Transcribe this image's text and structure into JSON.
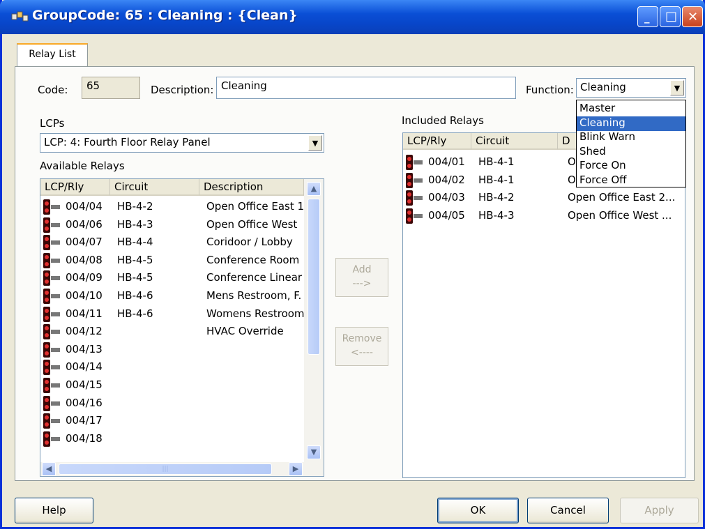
{
  "window": {
    "title": "GroupCode: 65 : Cleaning : {Clean}",
    "minimize_glyph": "_",
    "maximize_glyph": "□",
    "close_glyph": "✕"
  },
  "tabs": [
    {
      "label": "Relay List"
    }
  ],
  "form": {
    "code_label": "Code:",
    "code_value": "65",
    "description_label": "Description:",
    "description_value": "Cleaning",
    "function_label": "Function:",
    "function_value": "Cleaning"
  },
  "function_options": [
    "Master",
    "Cleaning",
    "Blink Warn",
    "Shed",
    "Force On",
    "Force Off"
  ],
  "function_selected_index": 1,
  "lcps": {
    "label": "LCPs",
    "selected": "LCP: 4: Fourth Floor Relay Panel"
  },
  "available": {
    "label": "Available Relays",
    "columns": [
      "LCP/Rly",
      "Circuit",
      "Description"
    ],
    "rows": [
      [
        "004/04",
        "HB-4-2",
        "Open Office East 1"
      ],
      [
        "004/06",
        "HB-4-3",
        "Open Office West"
      ],
      [
        "004/07",
        "HB-4-4",
        "Coridoor / Lobby"
      ],
      [
        "004/08",
        "HB-4-5",
        "Conference Room"
      ],
      [
        "004/09",
        "HB-4-5",
        "Conference Linear"
      ],
      [
        "004/10",
        "HB-4-6",
        "Mens Restroom, F."
      ],
      [
        "004/11",
        "HB-4-6",
        "Womens Restroom"
      ],
      [
        "004/12",
        "",
        "HVAC Override"
      ],
      [
        "004/13",
        "",
        ""
      ],
      [
        "004/14",
        "",
        ""
      ],
      [
        "004/15",
        "",
        ""
      ],
      [
        "004/16",
        "",
        ""
      ],
      [
        "004/17",
        "",
        ""
      ],
      [
        "004/18",
        "",
        ""
      ]
    ]
  },
  "included": {
    "label": "Included Relays",
    "columns": [
      "LCP/Rly",
      "Circuit",
      "D"
    ],
    "rows": [
      [
        "004/01",
        "HB-4-1",
        "O"
      ],
      [
        "004/02",
        "HB-4-1",
        "O"
      ],
      [
        "004/03",
        "HB-4-2",
        "Open Office East 2..."
      ],
      [
        "004/05",
        "HB-4-3",
        "Open Office West ..."
      ]
    ]
  },
  "transfer": {
    "add_label": "Add",
    "add_arrow": "--->",
    "remove_label": "Remove",
    "remove_arrow": "<----"
  },
  "scroll_glyphs": {
    "up": "▲",
    "down": "▼",
    "left": "◀",
    "right": "▶",
    "grip": "|||"
  },
  "buttons": {
    "help": "Help",
    "ok": "OK",
    "cancel": "Cancel",
    "apply": "Apply"
  },
  "colors": {
    "title_bar": "#0a4fd6",
    "selection": "#316ac5",
    "tab_accent": "#f9a927"
  }
}
